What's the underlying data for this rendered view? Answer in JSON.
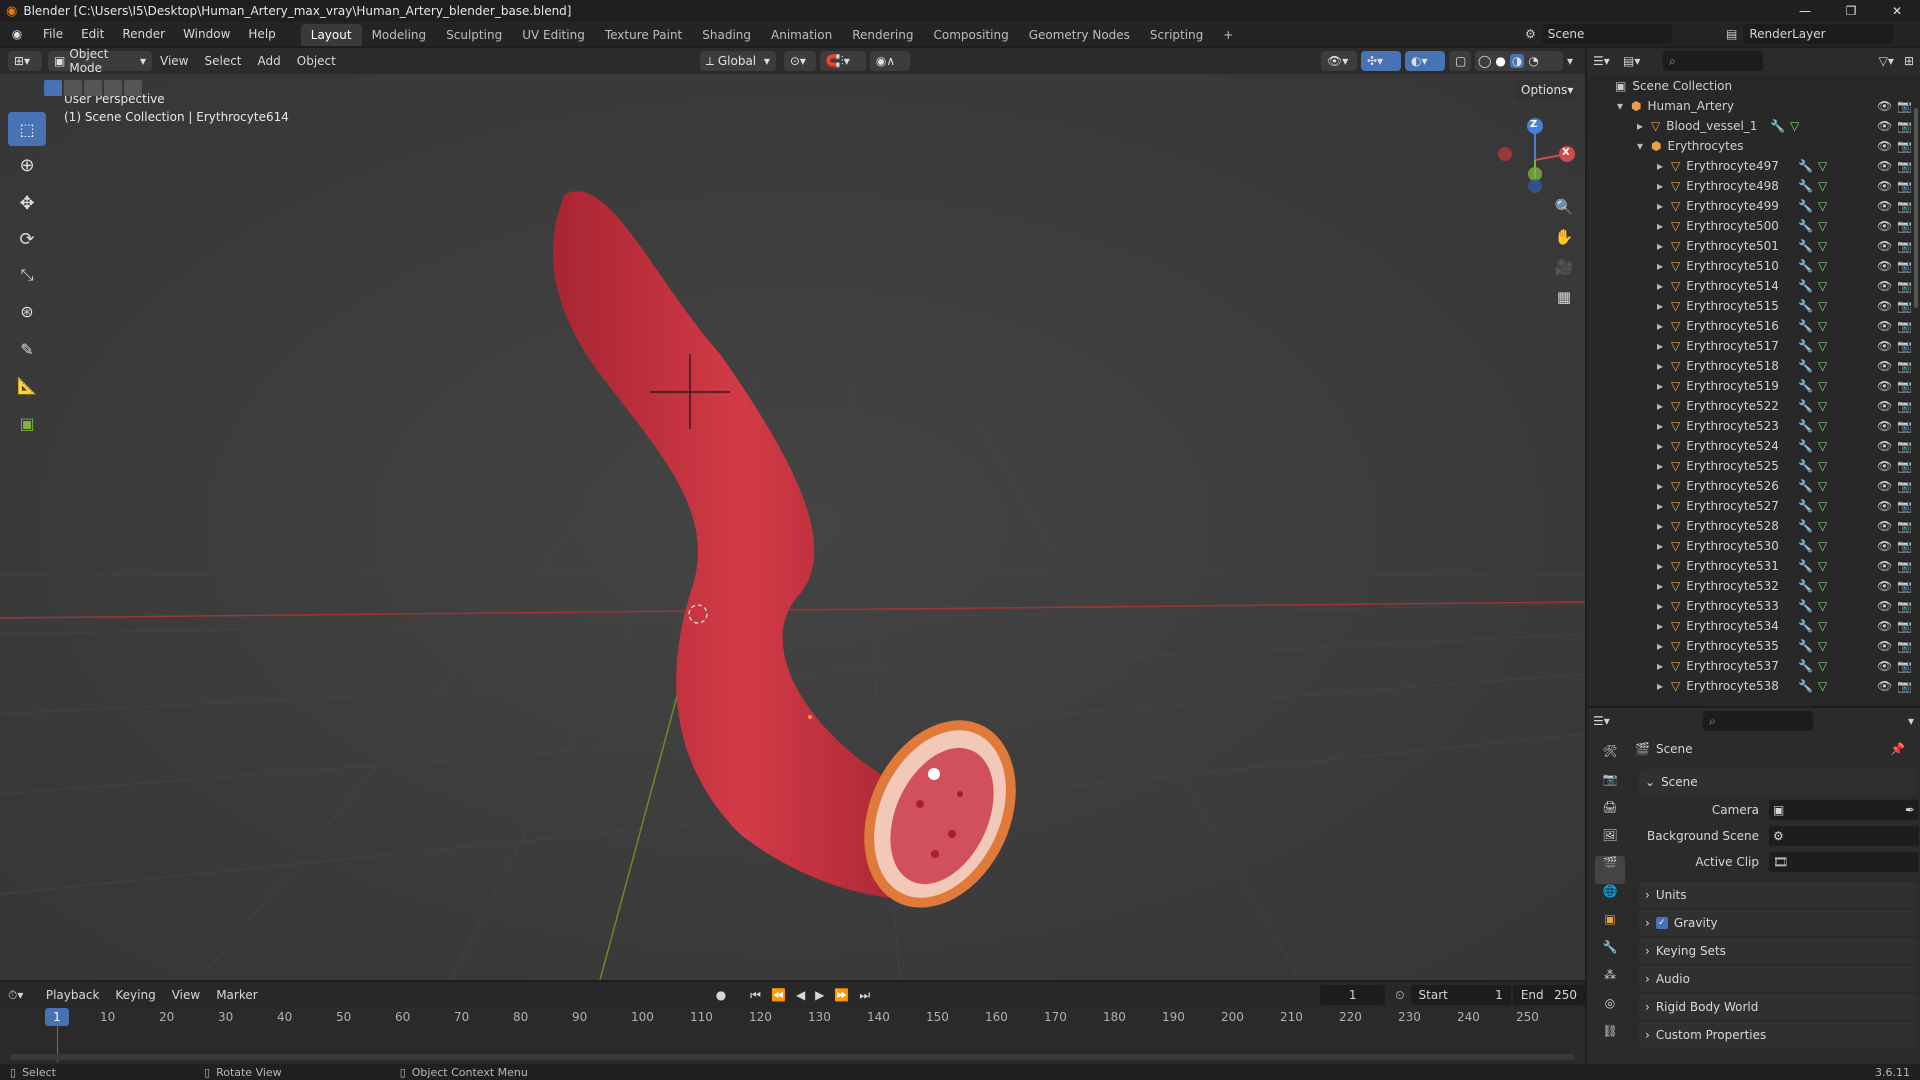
{
  "titlebar": {
    "title": "Blender [C:\\Users\\I5\\Desktop\\Human_Artery_max_vray\\Human_Artery_blender_base.blend]"
  },
  "menu": [
    "File",
    "Edit",
    "Render",
    "Window",
    "Help"
  ],
  "workspaces": [
    "Layout",
    "Modeling",
    "Sculpting",
    "UV Editing",
    "Texture Paint",
    "Shading",
    "Animation",
    "Rendering",
    "Compositing",
    "Geometry Nodes",
    "Scripting"
  ],
  "topright": {
    "scene": "Scene",
    "view_layer": "RenderLayer"
  },
  "viewport_header": {
    "mode": "Object Mode",
    "menus": [
      "View",
      "Select",
      "Add",
      "Object"
    ],
    "transform": "Global",
    "options": "Options"
  },
  "viewport": {
    "perspective": "User Perspective",
    "collection_info": "(1) Scene Collection | Erythrocyte614"
  },
  "gizmo": {
    "x": "X",
    "z": "Z"
  },
  "outliner": {
    "root": "Scene Collection",
    "collection": "Human_Artery",
    "vessel": "Blood_vessel_1",
    "sub": "Erythrocytes",
    "items": [
      "Erythrocyte497",
      "Erythrocyte498",
      "Erythrocyte499",
      "Erythrocyte500",
      "Erythrocyte501",
      "Erythrocyte510",
      "Erythrocyte514",
      "Erythrocyte515",
      "Erythrocyte516",
      "Erythrocyte517",
      "Erythrocyte518",
      "Erythrocyte519",
      "Erythrocyte522",
      "Erythrocyte523",
      "Erythrocyte524",
      "Erythrocyte525",
      "Erythrocyte526",
      "Erythrocyte527",
      "Erythrocyte528",
      "Erythrocyte530",
      "Erythrocyte531",
      "Erythrocyte532",
      "Erythrocyte533",
      "Erythrocyte534",
      "Erythrocyte535",
      "Erythrocyte537",
      "Erythrocyte538"
    ]
  },
  "properties": {
    "title": "Scene",
    "panel": "Scene",
    "camera_label": "Camera",
    "background_label": "Background Scene",
    "clip_label": "Active Clip",
    "sections": [
      "Units",
      "Gravity",
      "Keying Sets",
      "Audio",
      "Rigid Body World",
      "Custom Properties"
    ],
    "gravity_checked": true
  },
  "timeline": {
    "menus": [
      "Playback",
      "Keying",
      "View",
      "Marker"
    ],
    "current": "1",
    "start_label": "Start",
    "start": "1",
    "end_label": "End",
    "end": "250",
    "ruler": [
      "10",
      "20",
      "30",
      "40",
      "50",
      "60",
      "70",
      "80",
      "90",
      "100",
      "110",
      "120",
      "130",
      "140",
      "150",
      "160",
      "170",
      "180",
      "190",
      "200",
      "210",
      "220",
      "230",
      "240",
      "250"
    ],
    "frame_marker": "1"
  },
  "statusbar": {
    "select": "Select",
    "rotate": "Rotate View",
    "context": "Object Context Menu",
    "version": "3.6.11"
  },
  "colors": {
    "accent": "#4772b3",
    "artery": "#c8323f",
    "x_axis": "#d44a4a",
    "y_axis": "#7fb33a",
    "z_axis": "#4a7fd4"
  }
}
